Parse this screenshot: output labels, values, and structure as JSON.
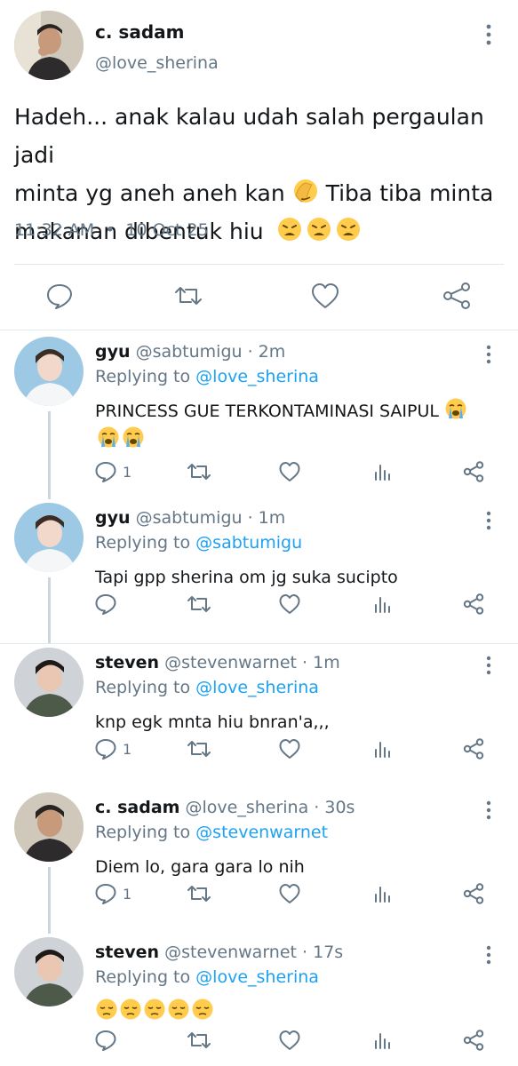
{
  "main_tweet": {
    "name": "c. sadam",
    "handle": "@love_sherina",
    "text_line1": "Hadeh... anak kalau udah salah pergaulan jadi",
    "text_line2a": "minta yg aneh aneh kan",
    "text_line2b": "Tiba tiba minta",
    "text_line3": "makanan dibentuk hiu",
    "time": "11:32 AM",
    "date": "10 Oct 25",
    "emoji_facepalm": "facepalm-emoji",
    "emoji_weary_count": 3
  },
  "replies": [
    {
      "name": "gyu",
      "handle": "@sabtumigu",
      "age": "2m",
      "replying_label": "Replying to",
      "replying_to": "@love_sherina",
      "text": "PRINCESS GUE TERKONTAMINASI SAIPUL",
      "emoji": "loudly-crying-emoji",
      "reply_count": "1"
    },
    {
      "name": "gyu",
      "handle": "@sabtumigu",
      "age": "1m",
      "replying_label": "Replying to",
      "replying_to": "@sabtumigu",
      "text": "Tapi gpp sherina om jg suka sucipto",
      "reply_count": ""
    },
    {
      "name": "steven",
      "handle": "@stevenwarnet",
      "age": "1m",
      "replying_label": "Replying to",
      "replying_to": "@love_sherina",
      "text": "knp egk mnta hiu bnran'a,,,",
      "reply_count": "1"
    },
    {
      "name": "c. sadam",
      "handle": "@love_sherina",
      "age": "30s",
      "replying_label": "Replying to",
      "replying_to": "@stevenwarnet",
      "text": "Diem lo, gara gara lo nih",
      "reply_count": "1"
    },
    {
      "name": "steven",
      "handle": "@stevenwarnet",
      "age": "17s",
      "replying_label": "Replying to",
      "replying_to": "@love_sherina",
      "text": "",
      "emoji": "pensive-face-emoji",
      "reply_count": ""
    }
  ],
  "colors": {
    "text": "#14171a",
    "secondary": "#657786",
    "link": "#1da1f2",
    "divider": "#e1e8ed"
  }
}
